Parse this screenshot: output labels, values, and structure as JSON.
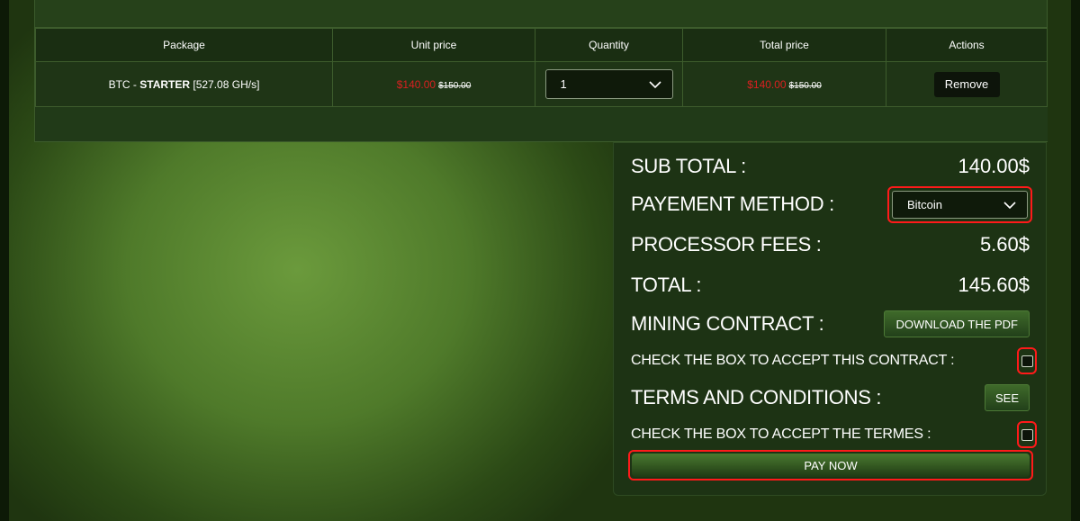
{
  "table": {
    "headers": [
      "Package",
      "Unit price",
      "Quantity",
      "Total price",
      "Actions"
    ],
    "row": {
      "package_prefix": "BTC - ",
      "package_name": "STARTER",
      "package_suffix": " [527.08 GH/s]",
      "unit_price_new": "$140.00",
      "unit_price_old": "$150.00",
      "quantity": "1",
      "total_price_new": "$140.00",
      "total_price_old": "$150.00",
      "remove_label": "Remove"
    }
  },
  "summary": {
    "subtotal_label": "SUB TOTAL :",
    "subtotal_value": "140.00$",
    "payment_label": "PAYEMENT METHOD :",
    "payment_selected": "Bitcoin",
    "fees_label": "PROCESSOR FEES :",
    "fees_value": "5.60$",
    "total_label": "TOTAL :",
    "total_value": "145.60$",
    "contract_label": "MINING CONTRACT :",
    "download_label": "DOWNLOAD THE PDF",
    "accept_contract_label": "CHECK THE BOX TO ACCEPT THIS CONTRACT :",
    "terms_label": "TERMS AND CONDITIONS :",
    "see_label": "SEE",
    "accept_terms_label": "CHECK THE BOX TO ACCEPT THE TERMES :",
    "pay_now_label": "PAY NOW"
  },
  "colors": {
    "sale_price": "#d82020",
    "highlight_border": "#ff1a1a",
    "panel_bg": "#1d3314"
  }
}
